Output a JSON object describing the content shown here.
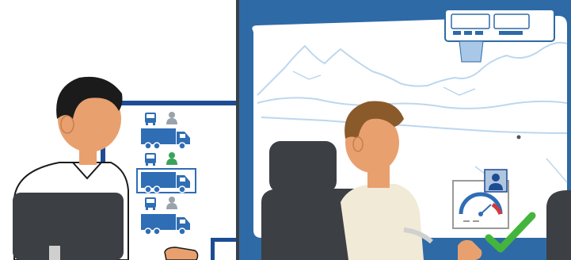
{
  "scene": {
    "panels": [
      "dispatcher-office",
      "truck-cab"
    ],
    "dispatcher_monitor": {
      "rows": [
        {
          "truck_icon": "truck-icon",
          "driver_icon": "driver-icon",
          "driver_color": "#9aa3ab",
          "highlighted": false
        },
        {
          "truck_icon": "truck-icon",
          "driver_icon": "driver-icon",
          "driver_color": "#3aa35a",
          "highlighted": true
        },
        {
          "truck_icon": "truck-icon",
          "driver_icon": "driver-icon",
          "driver_color": "#9aa3ab",
          "highlighted": false
        }
      ]
    },
    "cab_display": {
      "gauge_icon": "speedometer-icon",
      "profile_icon": "driver-profile-icon",
      "status_icon": "checkmark-icon",
      "status_color": "#44b53c"
    },
    "colors": {
      "cab_blue": "#2e6aa6",
      "monitor_blue": "#1d4c94",
      "icon_blue": "#2f6db5",
      "skin": "#e9a06f",
      "seat_gray": "#3c3f44",
      "window_sky": "#ffffff",
      "mountain_line": "#bcd7ee"
    }
  }
}
